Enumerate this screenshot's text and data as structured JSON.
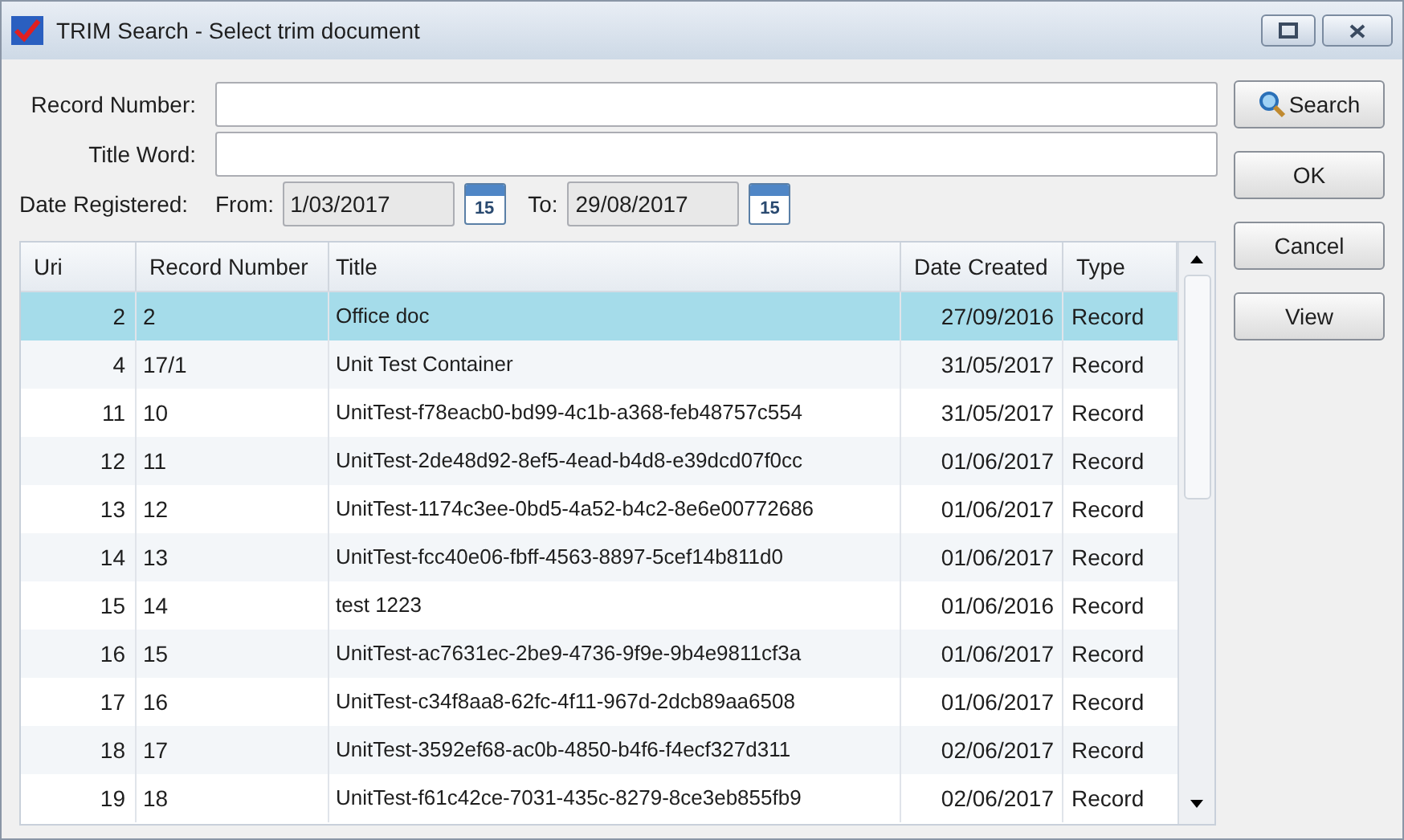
{
  "window": {
    "title": "TRIM Search - Select trim document"
  },
  "form": {
    "record_number_label": "Record Number:",
    "title_word_label": "Title Word:",
    "date_label": "Date Registered:",
    "from_label": "From:",
    "from_value": "1/03/2017",
    "calendar_from": "15",
    "to_label": "To:",
    "to_value": "29/08/2017",
    "calendar_to": "15"
  },
  "table": {
    "columns": [
      "Uri",
      "Record Number",
      "Title",
      "Date Created",
      "Type"
    ],
    "rows": [
      {
        "uri": "2",
        "record_number": "2",
        "title": "Office doc",
        "date_created": "27/09/2016",
        "type": "Record",
        "selected": true
      },
      {
        "uri": "4",
        "record_number": "17/1",
        "title": "Unit Test Container",
        "date_created": "31/05/2017",
        "type": "Record",
        "selected": false
      },
      {
        "uri": "11",
        "record_number": "10",
        "title": "UnitTest-f78eacb0-bd99-4c1b-a368-feb48757c554",
        "date_created": "31/05/2017",
        "type": "Record",
        "selected": false
      },
      {
        "uri": "12",
        "record_number": "11",
        "title": "UnitTest-2de48d92-8ef5-4ead-b4d8-e39dcd07f0cc",
        "date_created": "01/06/2017",
        "type": "Record",
        "selected": false
      },
      {
        "uri": "13",
        "record_number": "12",
        "title": "UnitTest-1174c3ee-0bd5-4a52-b4c2-8e6e00772686",
        "date_created": "01/06/2017",
        "type": "Record",
        "selected": false
      },
      {
        "uri": "14",
        "record_number": "13",
        "title": "UnitTest-fcc40e06-fbff-4563-8897-5cef14b811d0",
        "date_created": "01/06/2017",
        "type": "Record",
        "selected": false
      },
      {
        "uri": "15",
        "record_number": "14",
        "title": "test 1223",
        "date_created": "01/06/2016",
        "type": "Record",
        "selected": false
      },
      {
        "uri": "16",
        "record_number": "15",
        "title": "UnitTest-ac7631ec-2be9-4736-9f9e-9b4e9811cf3a",
        "date_created": "01/06/2017",
        "type": "Record",
        "selected": false
      },
      {
        "uri": "17",
        "record_number": "16",
        "title": "UnitTest-c34f8aa8-62fc-4f11-967d-2dcb89aa6508",
        "date_created": "01/06/2017",
        "type": "Record",
        "selected": false
      },
      {
        "uri": "18",
        "record_number": "17",
        "title": "UnitTest-3592ef68-ac0b-4850-b4f6-f4ecf327d311",
        "date_created": "02/06/2017",
        "type": "Record",
        "selected": false
      },
      {
        "uri": "19",
        "record_number": "18",
        "title": "UnitTest-f61c42ce-7031-435c-8279-8ce3eb855fb9",
        "date_created": "02/06/2017",
        "type": "Record",
        "selected": false
      }
    ]
  },
  "buttons": [
    "Search",
    "OK",
    "Cancel",
    "View"
  ]
}
